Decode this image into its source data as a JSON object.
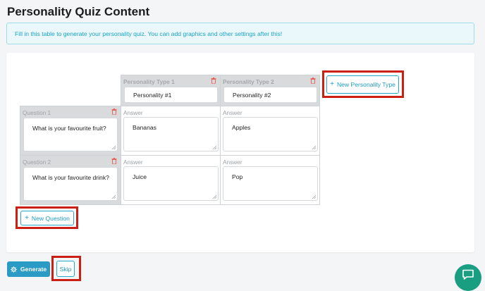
{
  "page": {
    "title": "Personality Quiz Content",
    "info": "Fill in this table to generate your personality quiz. You can add graphics and other settings after this!"
  },
  "table": {
    "personality_types": [
      {
        "label": "Personality Type 1",
        "value": "Personality #1"
      },
      {
        "label": "Personality Type 2",
        "value": "Personality #2"
      }
    ],
    "questions": [
      {
        "label": "Question 1",
        "text": "What is your favourite fruit?",
        "answers": [
          {
            "label": "Answer",
            "value": "Bananas"
          },
          {
            "label": "Answer",
            "value": "Apples"
          }
        ]
      },
      {
        "label": "Question 2",
        "text": "What is your favourite drink?",
        "answers": [
          {
            "label": "Answer",
            "value": "Juice"
          },
          {
            "label": "Answer",
            "value": "Pop"
          }
        ]
      }
    ],
    "new_personality_label": "New Personality Type",
    "new_question_label": "New Question"
  },
  "footer": {
    "generate_label": "Generate",
    "skip_label": "Skip"
  },
  "colors": {
    "accent": "#2a9bc4",
    "highlight": "#cc1f14",
    "chat": "#1a9e82"
  },
  "icons": {
    "delete": "trash-icon",
    "generate": "gear-icon",
    "chat": "chat-icon",
    "add": "plus-icon"
  }
}
